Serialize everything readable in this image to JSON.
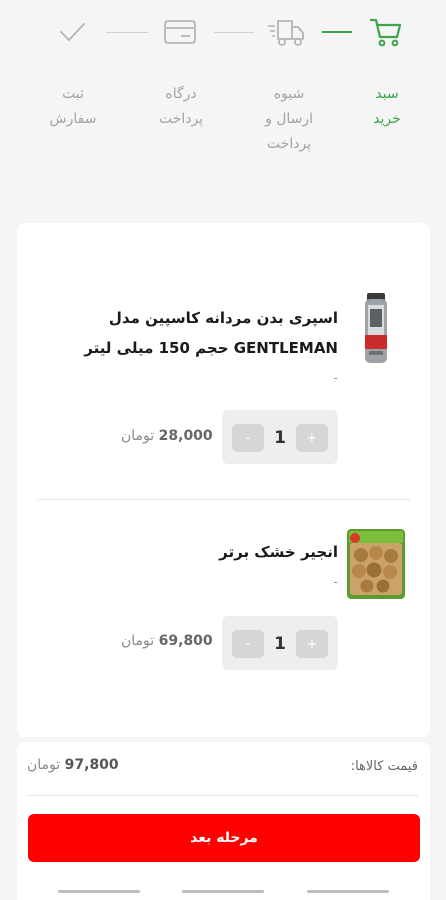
{
  "steps": [
    {
      "label_line1": "سبد",
      "label_line2": "خرید",
      "label_line3": "",
      "icon": "cart-icon",
      "active": true
    },
    {
      "label_line1": "شیوه",
      "label_line2": "ارسال و",
      "label_line3": "پرداخت",
      "icon": "truck-icon",
      "active": false
    },
    {
      "label_line1": "درگاه",
      "label_line2": "پرداخت",
      "label_line3": "",
      "icon": "credit-card-icon",
      "active": false
    },
    {
      "label_line1": "ثبت",
      "label_line2": "سفارش",
      "label_line3": "",
      "icon": "checkmark-icon",
      "active": false
    }
  ],
  "cart": {
    "items": [
      {
        "name": "اسپری بدن مردانه کاسپین مدل GENTLEMAN حجم 150 میلی لیتر",
        "variant": "-",
        "quantity": "1",
        "plus": "+",
        "minus": "-",
        "price": "28,000",
        "currency": "تومان",
        "image": "deodorant-spray-can"
      },
      {
        "name": "انجیر خشک برتر",
        "variant": "-",
        "quantity": "1",
        "plus": "+",
        "minus": "-",
        "price": "69,800",
        "currency": "تومان",
        "image": "dried-figs-package"
      }
    ]
  },
  "summary": {
    "label": "قیمت کالاها:",
    "total": "97,800",
    "currency": "تومان",
    "next_button": "مرحله بعد"
  },
  "colors": {
    "accent_green": "#3aa54a",
    "button_red": "#ff0000",
    "inactive_gray": "#a3a3a3"
  }
}
